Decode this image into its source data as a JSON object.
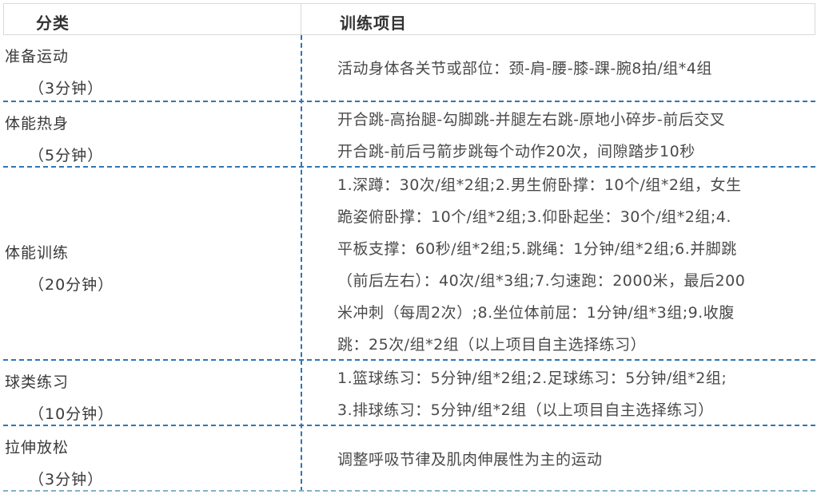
{
  "header": {
    "category": "分类",
    "items": "训练项目"
  },
  "rows": [
    {
      "name": "准备运动",
      "time": "（3分钟）",
      "lines": [
        "活动身体各关节或部位：颈-肩-腰-膝-踝-腕8拍/组*4组"
      ]
    },
    {
      "name": "体能热身",
      "time": "（5分钟）",
      "lines": [
        "开合跳-高抬腿-勾脚跳-并腿左右跳-原地小碎步-前后交叉",
        "开合跳-前后弓箭步跳每个动作20次，间隙踏步10秒"
      ]
    },
    {
      "name": "体能训练",
      "time": "（20分钟）",
      "lines": [
        "1.深蹲：30次/组*2组;2.男生俯卧撑：10个/组*2组，女生",
        "跪姿俯卧撑：10个/组*2组;3.仰卧起坐：30个/组*2组;4.",
        "平板支撑：60秒/组*2组;5.跳绳：1分钟/组*2组;6.并脚跳",
        "（前后左右）：40次/组*3组;7.匀速跑：2000米，最后200",
        "米冲刺（每周2次）;8.坐位体前屈：1分钟/组*3组;9.收腹",
        "跳：25次/组*2组（以上项目自主选择练习）"
      ]
    },
    {
      "name": "球类练习",
      "time": "（10分钟）",
      "lines": [
        "1.篮球练习：5分钟/组*2组;2.足球练习：5分钟/组*2组;",
        "3.排球练习：5分钟/组*2组（以上项目自主选择练习）"
      ]
    },
    {
      "name": "拉伸放松",
      "time": "（3分钟）",
      "lines": [
        "调整呼吸节律及肌肉伸展性为主的运动"
      ]
    }
  ]
}
